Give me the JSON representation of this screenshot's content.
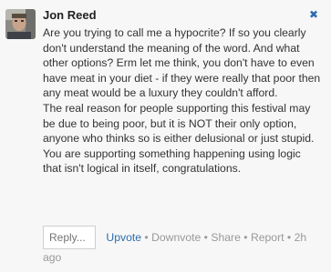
{
  "comment": {
    "author": "Jon Reed",
    "close_icon": "close-x-icon",
    "paragraphs": [
      "Are you trying to call me a hypocrite? If so you clearly don't understand the meaning of the word. And what other options? Erm let me think, you don't have to even have meat in your diet - if they were really that poor then any meat would be a luxury they couldn't afford.",
      "The real reason for people supporting this festival may be due to being poor, but it is NOT their only option, anyone who thinks so is either delusional or just stupid.",
      "You are supporting something happening using logic that isn't logical in itself, congratulations."
    ]
  },
  "actions": {
    "reply_placeholder": "Reply...",
    "upvote": "Upvote",
    "downvote": "Downvote",
    "share": "Share",
    "report": "Report",
    "time_line1": "2h",
    "time_line2": "ago",
    "separator": "•"
  },
  "colors": {
    "link": "#2b6dad",
    "muted": "#999999",
    "text": "#333333",
    "background": "#f7f7f7"
  }
}
